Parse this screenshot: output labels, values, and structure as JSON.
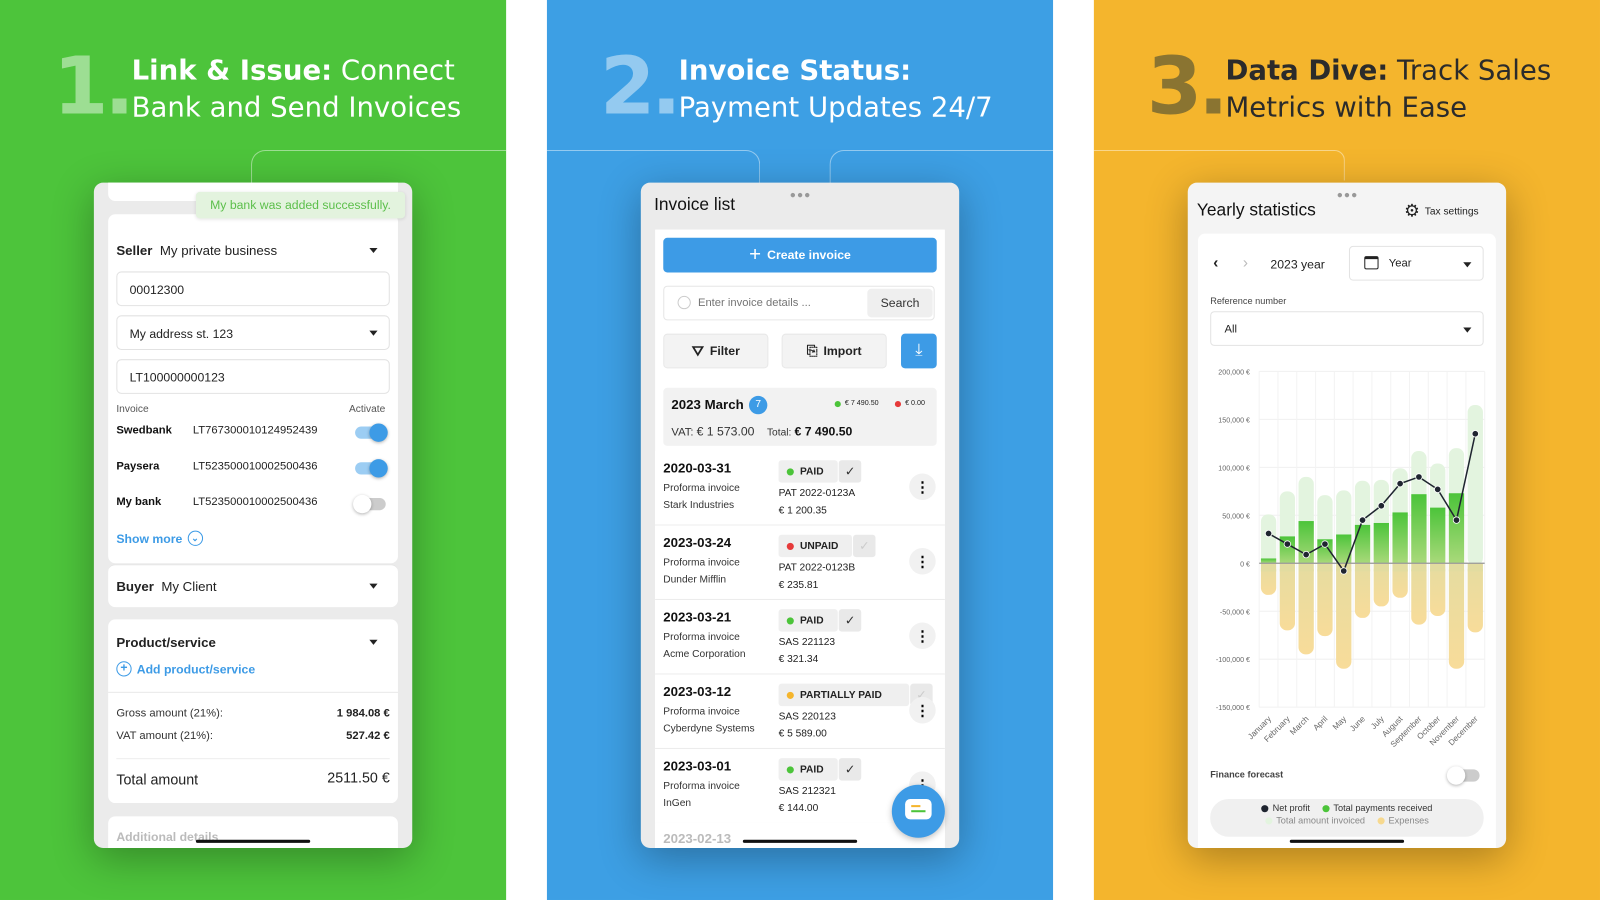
{
  "colors": {
    "green": "#4dc43b",
    "blue": "#3d9fe4",
    "yellow": "#f4b52d",
    "accent": "#3d9be6"
  },
  "panels": [
    {
      "number": "1.",
      "title_bold": "Link & Issue:",
      "title_rest": " Connect",
      "title_line2": "Bank and Send Invoices"
    },
    {
      "number": "2.",
      "title_bold": "Invoice Status:",
      "title_rest": "",
      "title_line2": "Payment Updates 24/7"
    },
    {
      "number": "3.",
      "title_bold": "Data Dive:",
      "title_rest": " Track Sales",
      "title_line2": "Metrics with Ease"
    }
  ],
  "screen1": {
    "toast": "My bank was added successfully.",
    "seller_label": "Seller",
    "seller_value": "My private business",
    "code": "00012300",
    "address": "My address st. 123",
    "vat_code": "LT100000000123",
    "invoice_label": "Invoice",
    "activate_label": "Activate",
    "banks": [
      {
        "name": "Swedbank",
        "iban": "LT767300010124952439",
        "active": true
      },
      {
        "name": "Paysera",
        "iban": "LT523500010002500436",
        "active": true
      },
      {
        "name": "My bank",
        "iban": "LT523500010002500436",
        "active": false
      }
    ],
    "show_more": "Show more",
    "buyer_label": "Buyer",
    "buyer_value": "My Client",
    "product_title": "Product/service",
    "add_product": "Add product/service",
    "gross_label": "Gross amount (21%):",
    "gross_value": "1 984.08 €",
    "vat_label": "VAT amount (21%):",
    "vat_value": "527.42 €",
    "total_label": "Total amount",
    "total_value": "2511.50 €",
    "additional": "Additional details"
  },
  "screen2": {
    "title": "Invoice list",
    "create": "Create invoice",
    "search_placeholder": "Enter invoice details ...",
    "search_btn": "Search",
    "filter": "Filter",
    "import": "Import",
    "month": "2023 March",
    "month_count": "7",
    "paid_sum": "€ 7 490.50",
    "unpaid_sum": "€ 0.00",
    "vat_label": "VAT:",
    "vat_value": "€ 1 573.00",
    "total_label": "Total:",
    "total_value": "€ 7 490.50",
    "invoices": [
      {
        "date": "2020-03-31",
        "type": "Proforma invoice",
        "client": "Stark Industries",
        "status": "PAID",
        "status_color": "#4cc43a",
        "ref": "PAT 2022-0123A",
        "amount": "€ 1 200.35",
        "checked": true
      },
      {
        "date": "2023-03-24",
        "type": "Proforma invoice",
        "client": "Dunder Mifflin",
        "status": "UNPAID",
        "status_color": "#e63a3a",
        "ref": "PAT 2022-0123B",
        "amount": "€ 235.81",
        "checked": false
      },
      {
        "date": "2023-03-21",
        "type": "Proforma invoice",
        "client": "Acme Corporation",
        "status": "PAID",
        "status_color": "#4cc43a",
        "ref": "SAS 221123",
        "amount": "€ 321.34",
        "checked": true
      },
      {
        "date": "2023-03-12",
        "type": "Proforma invoice",
        "client": "Cyberdyne Systems",
        "status": "PARTIALLY PAID",
        "status_color": "#f5b52c",
        "ref": "SAS 220123",
        "amount": "€ 5 589.00",
        "checked": false
      },
      {
        "date": "2023-03-01",
        "type": "Proforma invoice",
        "client": "InGen",
        "status": "PAID",
        "status_color": "#4cc43a",
        "ref": "SAS 212321",
        "amount": "€ 144.00",
        "checked": true
      }
    ],
    "next_date": "2023-02-13"
  },
  "screen3": {
    "title": "Yearly statistics",
    "tax_settings": "Tax settings",
    "period": "2023 year",
    "period_type": "Year",
    "ref_label": "Reference number",
    "ref_value": "All",
    "forecast_label": "Finance forecast",
    "forecast_on": false
  },
  "chart_data": {
    "type": "bar",
    "categories": [
      "January",
      "February",
      "March",
      "April",
      "May",
      "June",
      "July",
      "August",
      "September",
      "October",
      "November",
      "December"
    ],
    "y_ticks": [
      200000,
      150000,
      100000,
      50000,
      0,
      -50000,
      -100000,
      -150000
    ],
    "y_tick_labels": [
      "200,000 €",
      "150,000 €",
      "100,000 €",
      "50,000 €",
      "0 €",
      "-50,000 €",
      "-100,000 €",
      "-150,000 €"
    ],
    "ylim": [
      -150000,
      200000
    ],
    "grid": true,
    "legend_placement": "bottom",
    "series": [
      {
        "name": "Total amount invoiced",
        "kind": "bar",
        "color": "#e3f4df",
        "values": [
          51000,
          75000,
          90000,
          71000,
          76000,
          86000,
          87000,
          99000,
          117000,
          104000,
          120000,
          165000
        ]
      },
      {
        "name": "Total payments received",
        "kind": "bar",
        "color": "#4cc43a",
        "values": [
          5000,
          28000,
          44000,
          25000,
          30000,
          40000,
          42000,
          53000,
          72000,
          58000,
          73000,
          0
        ]
      },
      {
        "name": "Expenses",
        "kind": "bar",
        "color": "#f7d98f",
        "values": [
          -33000,
          -70000,
          -95000,
          -76000,
          -110000,
          -57000,
          -45000,
          -36000,
          -64000,
          -55000,
          -110000,
          -72000
        ]
      },
      {
        "name": "Net profit",
        "kind": "line",
        "color": "#1f2530",
        "values": [
          31000,
          20000,
          9000,
          20000,
          -8000,
          45000,
          60000,
          83000,
          90000,
          77000,
          45000,
          135000
        ]
      }
    ]
  }
}
